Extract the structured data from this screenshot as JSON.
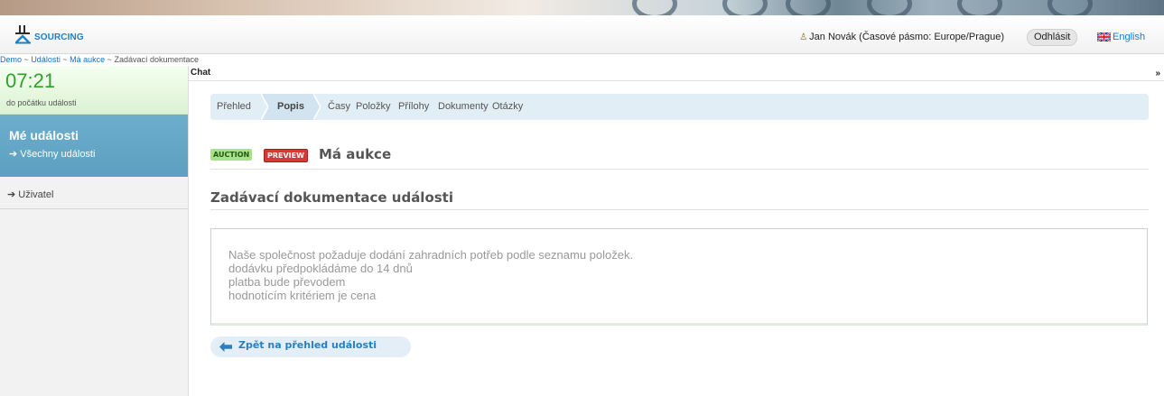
{
  "header": {
    "logo_text": "SOURCING",
    "user_name": "Jan Novák (Časové pásmo: Europe/Prague)",
    "logout_label": "Odhlásit",
    "language_label": "English"
  },
  "breadcrumb": {
    "items": [
      "Demo",
      "Události",
      "Má aukce"
    ],
    "separator": "~",
    "current": "Zadávací dokumentace"
  },
  "sidebar": {
    "countdown_time": "07:21",
    "countdown_label": "do počátku události",
    "my_events_title": "Mé události",
    "all_events_link": "➔ Všechny události",
    "user_link": "➔ Uživatel"
  },
  "chat": {
    "label": "Chat",
    "collapse_glyph": "»"
  },
  "tabs": {
    "items": [
      "Přehled",
      "Popis",
      "Časy",
      "Položky",
      "Přílohy",
      "Dokumenty",
      "Otázky"
    ],
    "active": "Popis"
  },
  "event": {
    "type_badge": "AUCTION",
    "status_badge": "PREVIEW",
    "name": "Má aukce"
  },
  "section": {
    "title": "Zadávací dokumentace události"
  },
  "document": {
    "lines": [
      "Naše společnost požaduje dodání zahradních potřeb podle seznamu položek.",
      "dodávku předpokládáme do 14 dnů",
      "platba bude převodem",
      "hodnotícím kritériem je cena"
    ]
  },
  "back_button": {
    "label": "Zpět na přehled události"
  },
  "colors": {
    "accent_blue": "#1a7cc9",
    "timer_green": "#2fa22a",
    "sidebar_blue": "#6daecd",
    "badge_auction": "#a8e08c",
    "badge_preview": "#d23b35"
  }
}
